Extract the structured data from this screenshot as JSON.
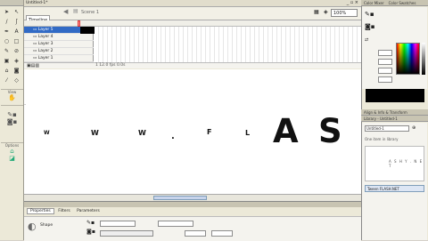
{
  "toolbar": {
    "view_label": "View",
    "options_label": "Options",
    "tools": [
      {
        "icon": "arrow-tool-icon",
        "glyph": "➤"
      },
      {
        "icon": "subselect-tool-icon",
        "glyph": "↖"
      },
      {
        "icon": "line-tool-icon",
        "glyph": "/"
      },
      {
        "icon": "lasso-tool-icon",
        "glyph": "ʃ"
      },
      {
        "icon": "pen-tool-icon",
        "glyph": "✒"
      },
      {
        "icon": "text-tool-icon",
        "glyph": "A"
      },
      {
        "icon": "oval-tool-icon",
        "glyph": "○"
      },
      {
        "icon": "rectangle-tool-icon",
        "glyph": "□"
      },
      {
        "icon": "pencil-tool-icon",
        "glyph": "✎"
      },
      {
        "icon": "brush-tool-icon",
        "glyph": "⊘"
      },
      {
        "icon": "freetransform-tool-icon",
        "glyph": "▣"
      },
      {
        "icon": "filltransform-tool-icon",
        "glyph": "◈"
      },
      {
        "icon": "inkbottle-tool-icon",
        "glyph": "⌂"
      },
      {
        "icon": "paintbucket-tool-icon",
        "glyph": "◙"
      },
      {
        "icon": "eyedropper-tool-icon",
        "glyph": "⁄"
      },
      {
        "icon": "eraser-tool-icon",
        "glyph": "◇"
      }
    ]
  },
  "document": {
    "title": "Untitled-1*",
    "tab_label": "Timeline",
    "scene_label": "Scene 1",
    "zoom": "100%"
  },
  "timeline": {
    "layers": [
      "Layer 5",
      "Layer 4",
      "Layer 3",
      "Layer 2",
      "Layer 1"
    ],
    "status": "1   12.0 fps   0.0s"
  },
  "stage": {
    "letters": [
      "W",
      "W",
      "W",
      ".",
      "F",
      "L",
      "A",
      "S"
    ]
  },
  "properties": {
    "tabs": [
      "Properties",
      "Filters",
      "Parameters"
    ],
    "type_label": "Shape",
    "field1": "",
    "field2": ""
  },
  "panels": {
    "color_header": "Color Mixer",
    "swatches_header": "Color Swatches",
    "align_header": "Align & Info & Transform",
    "library_header": "Library - Untitled-1",
    "library_doc": "Untitled-1",
    "library_count": "One item in library",
    "library_preview": "A S H Y . N E T",
    "library_item": "Tween FLASH.NET",
    "color_values": {
      "r": "0",
      "g": "0",
      "b": "0",
      "alpha": "100%",
      "hex": "#000000"
    },
    "accent": "#3a6ea5"
  }
}
